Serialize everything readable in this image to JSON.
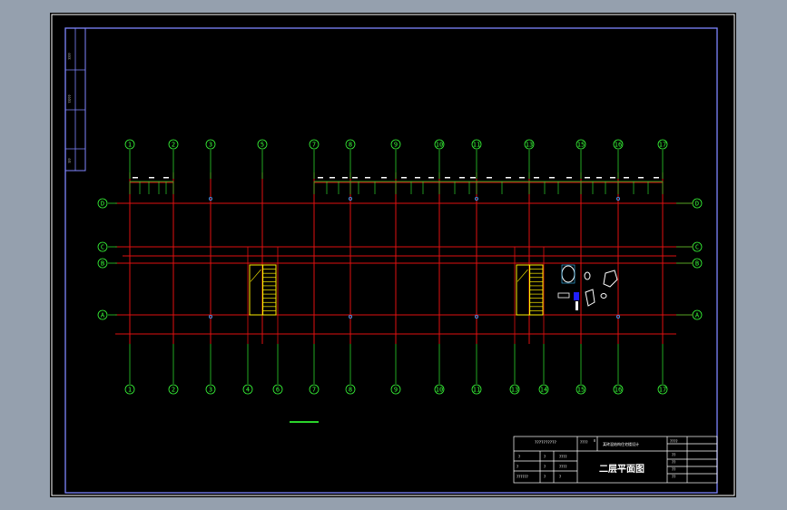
{
  "colors": {
    "background": "#95a0ae",
    "sheet": "#000000",
    "frame": "#7f86ff",
    "axis": "#2bd42b",
    "axis_bubble": "#39ff39",
    "wall": "#e01010",
    "stair": "#ffee00",
    "fixture": "#ffffff",
    "column_dot": "#30a0ff"
  },
  "grid_axes": {
    "top_labels": [
      "1",
      "2",
      "3",
      "5",
      "7",
      "8",
      "9",
      "10",
      "11",
      "13",
      "15",
      "16",
      "17"
    ],
    "bottom_labels": [
      "1",
      "2",
      "3",
      "4",
      "6",
      "7",
      "8",
      "9",
      "10",
      "11",
      "13",
      "14",
      "15",
      "16",
      "17"
    ],
    "left_labels": [
      "D",
      "C",
      "B",
      "A"
    ],
    "right_labels": [
      "D",
      "C",
      "B",
      "A"
    ]
  },
  "title_block": {
    "drawing_title": "二层平面图",
    "school_name": "??????????",
    "project_code": "????",
    "project_name": "某砖混结构住宅楼设计",
    "sheet_no": "????",
    "cell_a": "?",
    "cell_b": "?",
    "cell_c": "????",
    "cell_d": "????",
    "cell_e": "??????",
    "side_cells": [
      "??",
      "??",
      "??",
      "??"
    ],
    "left_small_cells": [
      "?",
      "?",
      "?",
      "?"
    ]
  },
  "side_strip": {
    "labels": [
      "????",
      "?????",
      "???"
    ]
  }
}
